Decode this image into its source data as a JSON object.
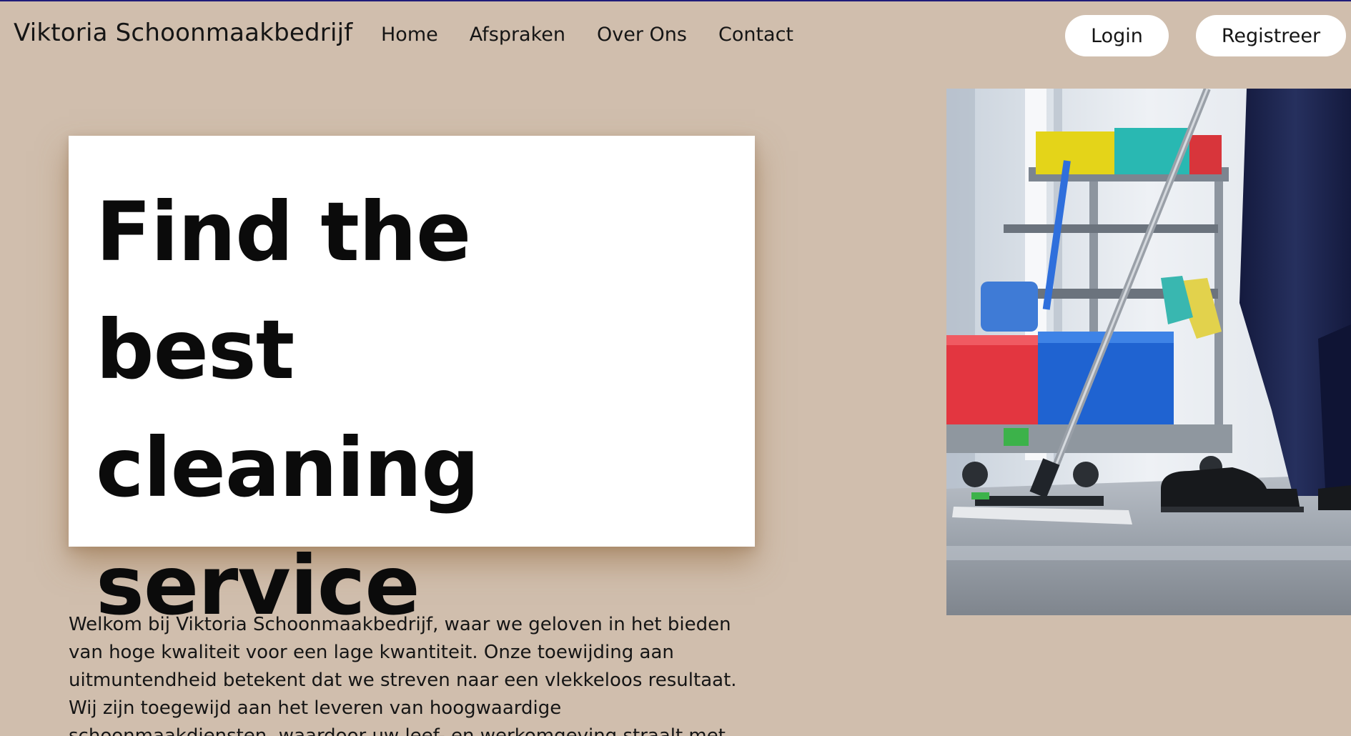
{
  "brand": {
    "name": "Viktoria Schoonmaakbedrijf"
  },
  "nav": {
    "links": [
      "Home",
      "Afspraken",
      "Over Ons",
      "Contact"
    ]
  },
  "auth": {
    "login_label": "Login",
    "register_label": "Registreer"
  },
  "hero": {
    "title": "Find the best cleaning service",
    "intro": "Welkom bij Viktoria Schoonmaakbedrijf, waar we geloven in het bieden van hoge kwaliteit voor een lage kwantiteit. Onze toewijding aan uitmuntendheid betekent dat we streven naar een vlekkeloos resultaat. Wij zijn toegewijd aan het leveren van hoogwaardige schoonmaakdiensten, waardoor uw leef- en werkomgeving straalt met",
    "image_subject": "janitor-mopping-with-cleaning-cart"
  },
  "colors": {
    "background": "#d0bead",
    "card": "#ffffff",
    "button": "#ffffff",
    "text": "#151515",
    "top_border": "#1f1c7a"
  }
}
